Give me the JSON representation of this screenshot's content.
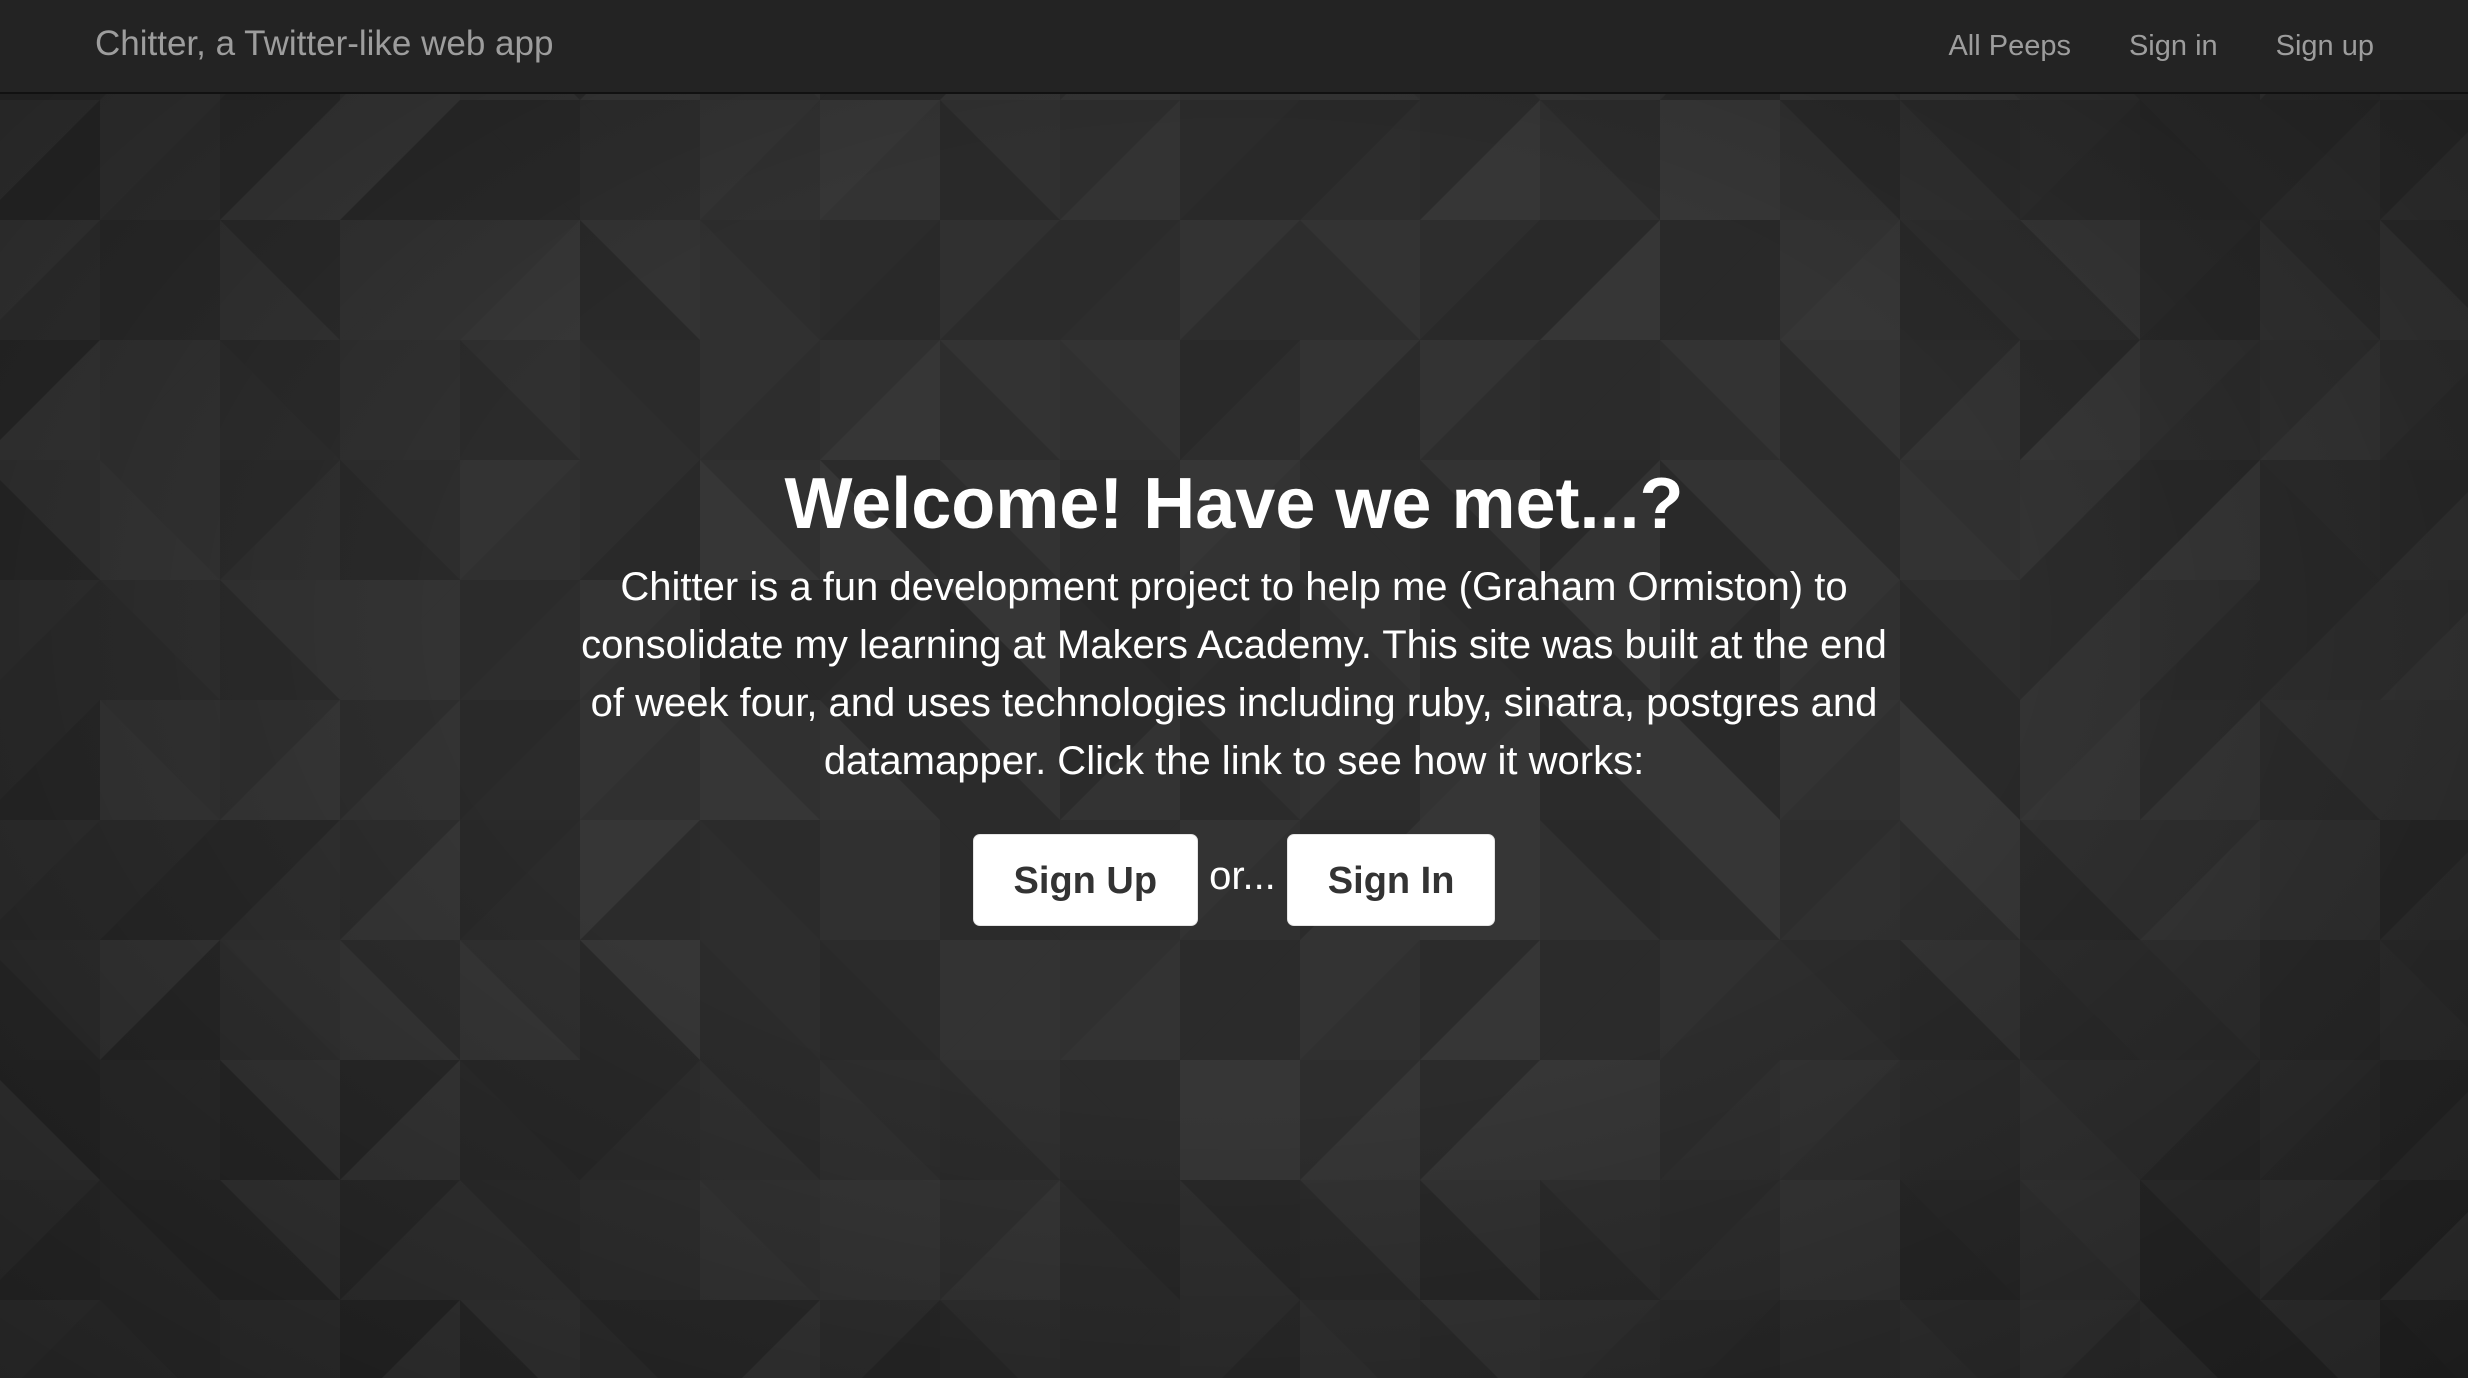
{
  "navbar": {
    "brand": "Chitter, a Twitter-like web app",
    "links": [
      {
        "label": "All Peeps"
      },
      {
        "label": "Sign in"
      },
      {
        "label": "Sign up"
      }
    ]
  },
  "hero": {
    "title": "Welcome! Have we met...?",
    "description": "Chitter is a fun development project to help me (Graham Ormiston) to consolidate my learning at Makers Academy. This site was built at the end of week four, and uses technologies including ruby, sinatra, postgres and datamapper. Click the link to see how it works:",
    "signup_label": "Sign Up",
    "or_label": "or...",
    "signin_label": "Sign In"
  },
  "colors": {
    "navbar_bg": "#232323",
    "page_bg": "#2e2e2e",
    "nav_text": "#9d9d9d",
    "button_bg": "#ffffff",
    "button_text": "#333333"
  }
}
